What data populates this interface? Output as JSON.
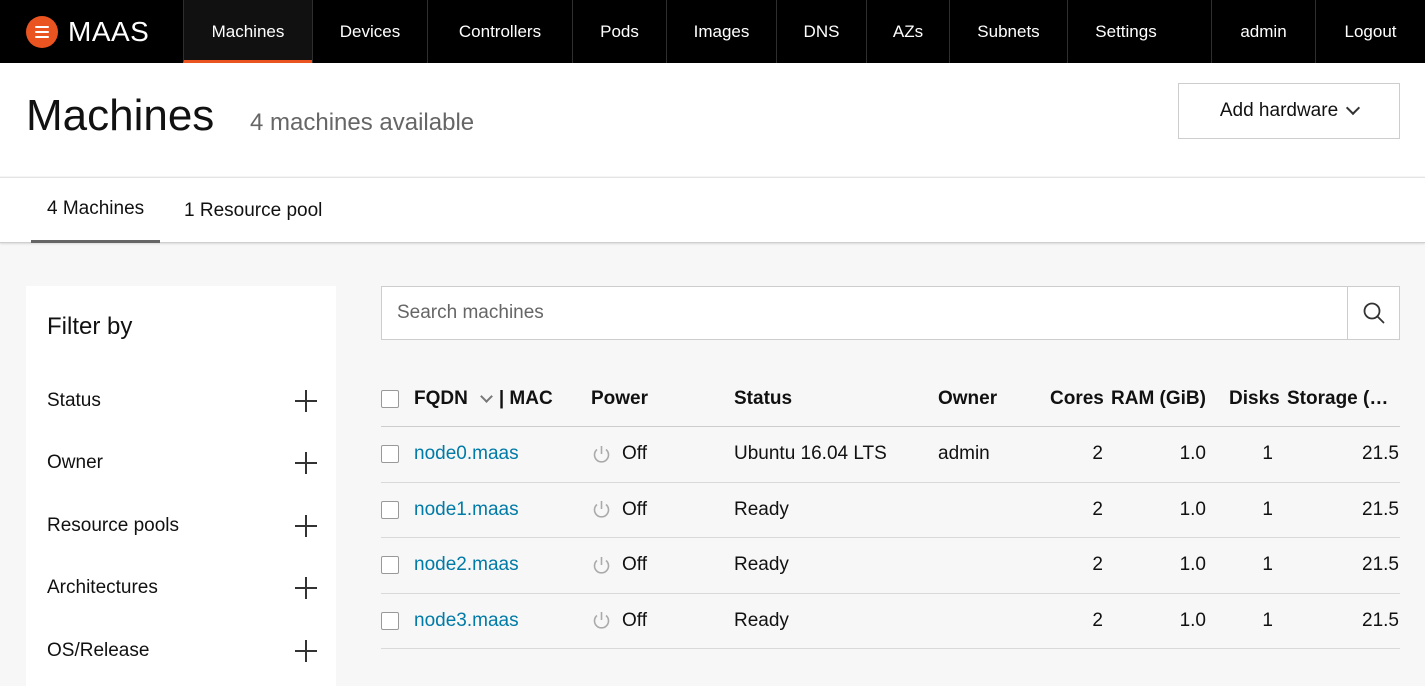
{
  "brand": {
    "name": "MAAS",
    "accent": "#e95420"
  },
  "nav": {
    "items": [
      "Machines",
      "Devices",
      "Controllers",
      "Pods",
      "Images",
      "DNS",
      "AZs",
      "Subnets",
      "Settings"
    ],
    "user": "admin",
    "logout": "Logout",
    "active": "Machines"
  },
  "header": {
    "title": "Machines",
    "subtitle": "4 machines available",
    "add_hardware_label": "Add hardware"
  },
  "tabs": [
    "4 Machines",
    "1 Resource pool"
  ],
  "filter": {
    "title": "Filter by",
    "items": [
      "Status",
      "Owner",
      "Resource pools",
      "Architectures",
      "OS/Release"
    ]
  },
  "search": {
    "placeholder": "Search machines",
    "value": ""
  },
  "table": {
    "headers": {
      "fqdn": "FQDN",
      "mac": "| MAC",
      "power": "Power",
      "status": "Status",
      "owner": "Owner",
      "cores": "Cores",
      "ram": "RAM (GiB)",
      "disks": "Disks",
      "storage": "Storage (…"
    },
    "rows": [
      {
        "fqdn": "node0.maas",
        "power": "Off",
        "status": "Ubuntu 16.04 LTS",
        "owner": "admin",
        "cores": "2",
        "ram": "1.0",
        "disks": "1",
        "storage": "21.5"
      },
      {
        "fqdn": "node1.maas",
        "power": "Off",
        "status": "Ready",
        "owner": "",
        "cores": "2",
        "ram": "1.0",
        "disks": "1",
        "storage": "21.5"
      },
      {
        "fqdn": "node2.maas",
        "power": "Off",
        "status": "Ready",
        "owner": "",
        "cores": "2",
        "ram": "1.0",
        "disks": "1",
        "storage": "21.5"
      },
      {
        "fqdn": "node3.maas",
        "power": "Off",
        "status": "Ready",
        "owner": "",
        "cores": "2",
        "ram": "1.0",
        "disks": "1",
        "storage": "21.5"
      }
    ]
  },
  "colors": {
    "nav_bg": "#000000",
    "link": "#007aa6",
    "page_bg": "#f7f7f7"
  }
}
